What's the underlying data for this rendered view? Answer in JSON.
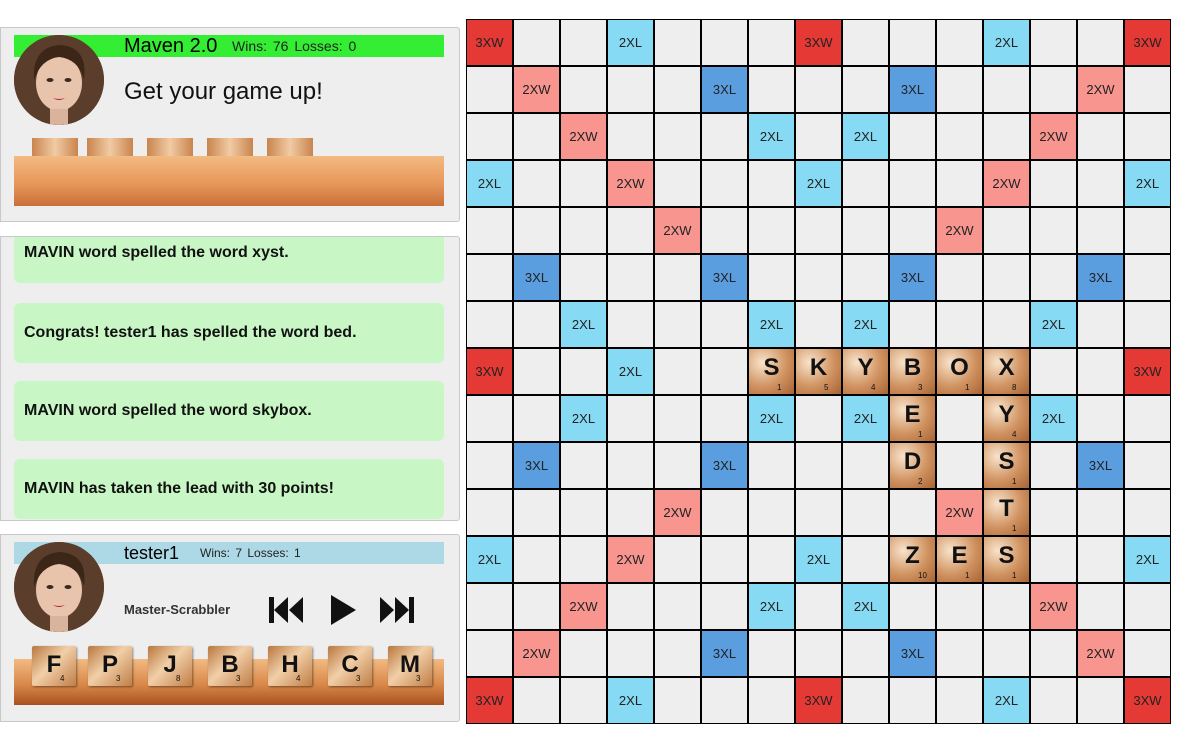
{
  "opponent": {
    "name": "Maven 2.0",
    "stats": "Wins: 76    Losses: 0",
    "taunt": "Get your game up!",
    "bar_color": "#33ee33"
  },
  "messages": [
    "MAVIN word spelled the word xyst.",
    "Congrats! tester1 has spelled the word bed.",
    "MAVIN word spelled the word skybox.",
    "MAVIN has taken the lead with 30 points!"
  ],
  "player": {
    "name": "tester1",
    "stats": "Wins: 7    Losses: 1",
    "rank": "Master-Scrabbler",
    "bar_color": "#add8e6",
    "rack": [
      {
        "letter": "F",
        "points": "4"
      },
      {
        "letter": "P",
        "points": "3"
      },
      {
        "letter": "J",
        "points": "8"
      },
      {
        "letter": "B",
        "points": "3"
      },
      {
        "letter": "H",
        "points": "4"
      },
      {
        "letter": "C",
        "points": "3"
      },
      {
        "letter": "M",
        "points": "3"
      }
    ],
    "controls": [
      "previous-icon",
      "play-icon",
      "next-icon"
    ]
  },
  "board": {
    "premium_labels": {
      "tw": "3XW",
      "dw": "2XW",
      "tl": "3XL",
      "dl": "2XL"
    },
    "colors": {
      "tw": "#e53935",
      "dw": "#f8958f",
      "tl": "#5b9ee0",
      "dl": "#87daf4",
      "empty": "#eeeeee"
    },
    "layout": [
      "T..d...T...d..T",
      ".D...t...t...D.",
      "..D...d.d...D..",
      "d..D...d...D..d",
      "....D.....D....",
      ".t...t...t...t.",
      "..d...d.d...d..",
      "T..d.......d..T",
      "..d...d.d...d..",
      ".t...t...t...t.",
      "....D.....D....",
      "d..D...d...D..d",
      "..D...d.d...D..",
      ".D...t...t...D.",
      "T..d...T...d..T"
    ],
    "tiles": [
      {
        "row": 7,
        "col": 6,
        "letter": "S",
        "points": "1"
      },
      {
        "row": 7,
        "col": 7,
        "letter": "K",
        "points": "5"
      },
      {
        "row": 7,
        "col": 8,
        "letter": "Y",
        "points": "4"
      },
      {
        "row": 7,
        "col": 9,
        "letter": "B",
        "points": "3"
      },
      {
        "row": 7,
        "col": 10,
        "letter": "O",
        "points": "1"
      },
      {
        "row": 7,
        "col": 11,
        "letter": "X",
        "points": "8"
      },
      {
        "row": 8,
        "col": 9,
        "letter": "E",
        "points": "1"
      },
      {
        "row": 9,
        "col": 9,
        "letter": "D",
        "points": "2"
      },
      {
        "row": 8,
        "col": 11,
        "letter": "Y",
        "points": "4"
      },
      {
        "row": 9,
        "col": 11,
        "letter": "S",
        "points": "1"
      },
      {
        "row": 10,
        "col": 11,
        "letter": "T",
        "points": "1"
      },
      {
        "row": 11,
        "col": 9,
        "letter": "Z",
        "points": "10"
      },
      {
        "row": 11,
        "col": 10,
        "letter": "E",
        "points": "1"
      },
      {
        "row": 11,
        "col": 11,
        "letter": "S",
        "points": "1"
      }
    ]
  }
}
